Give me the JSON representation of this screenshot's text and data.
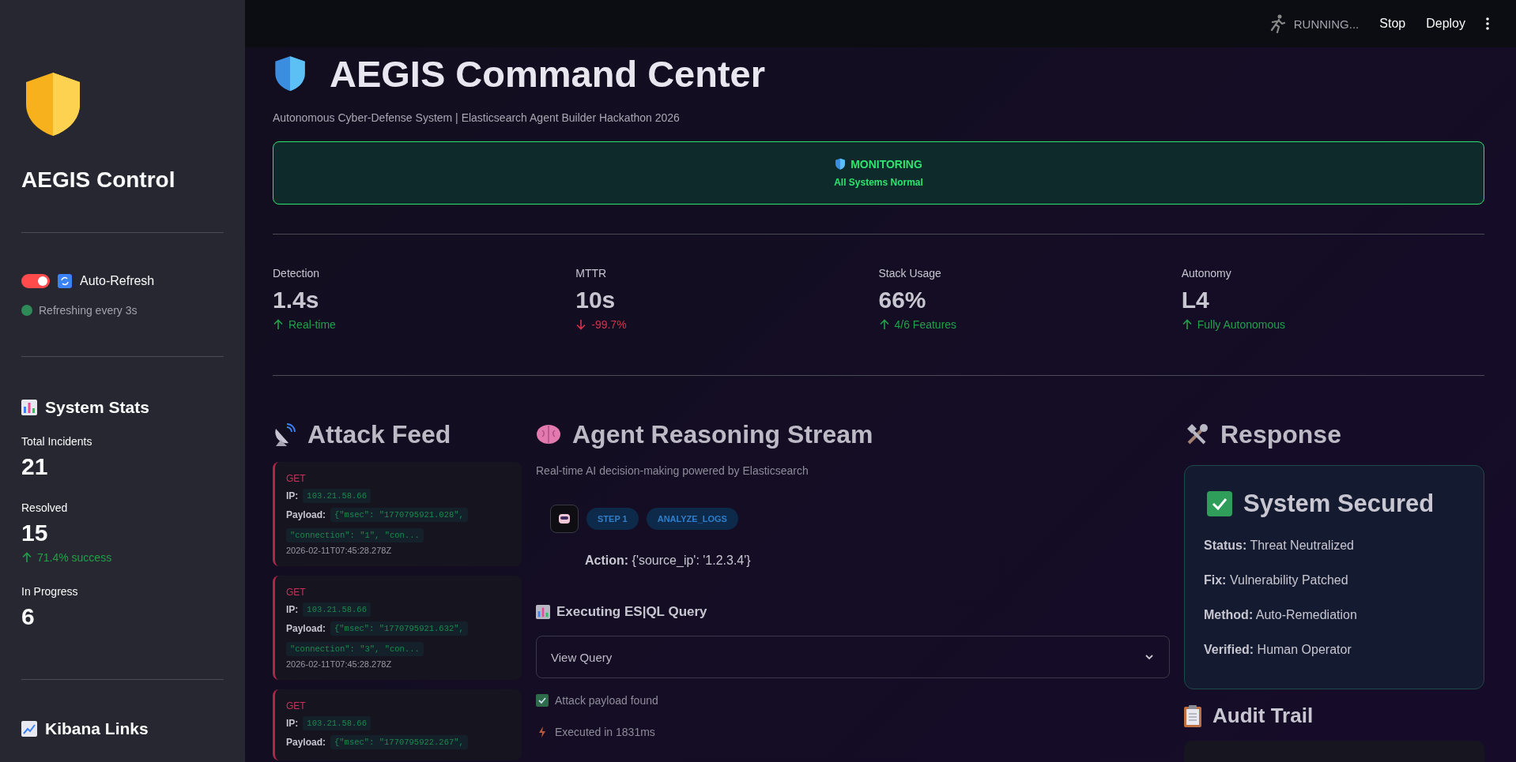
{
  "sidebar": {
    "title": "AEGIS Control",
    "auto_refresh": {
      "label": "Auto-Refresh",
      "on": true
    },
    "refresh_status": {
      "text": "Refreshing every 3s",
      "color": "#2e8b57"
    },
    "stats_heading": "System Stats",
    "stats": [
      {
        "label": "Total Incidents",
        "value": "21"
      },
      {
        "label": "Resolved",
        "value": "15",
        "delta": "71.4% success",
        "kind": "up"
      },
      {
        "label": "In Progress",
        "value": "6"
      }
    ],
    "links_heading": "Kibana Links"
  },
  "toolbar": {
    "status": "RUNNING...",
    "buttons": [
      "Stop",
      "Deploy"
    ]
  },
  "header": {
    "title": "AEGIS Command Center",
    "subtitle": "Autonomous Cyber-Defense System | Elasticsearch Agent Builder Hackathon 2026"
  },
  "banner": {
    "status": "MONITORING",
    "detail": "All Systems Normal"
  },
  "metrics": [
    {
      "label": "Detection",
      "value": "1.4s",
      "delta": "Real-time",
      "kind": "up"
    },
    {
      "label": "MTTR",
      "value": "10s",
      "delta": "-99.7%",
      "kind": "down"
    },
    {
      "label": "Stack Usage",
      "value": "66%",
      "delta": "4/6 Features",
      "kind": "up"
    },
    {
      "label": "Autonomy",
      "value": "L4",
      "delta": "Fully Autonomous",
      "kind": "up"
    }
  ],
  "attack_feed": {
    "heading": "Attack Feed",
    "events": [
      {
        "method": "GET",
        "ip_label": "IP:",
        "ip": "103.21.58.66",
        "payload_label": "Payload:",
        "payload": [
          "{\"msec\": \"1770795921.028\",",
          "\"connection\": \"1\", \"con..."
        ],
        "timestamp": "2026-02-11T07:45:28.278Z"
      },
      {
        "method": "GET",
        "ip_label": "IP:",
        "ip": "103.21.58.66",
        "payload_label": "Payload:",
        "payload": [
          "{\"msec\": \"1770795921.632\",",
          "\"connection\": \"3\", \"con..."
        ],
        "timestamp": "2026-02-11T07:45:28.278Z"
      },
      {
        "method": "GET",
        "ip_label": "IP:",
        "ip": "103.21.58.66",
        "payload_label": "Payload:",
        "payload": [
          "{\"msec\": \"1770795922.267\","
        ]
      }
    ]
  },
  "reasoning": {
    "heading": "Agent Reasoning Stream",
    "caption": "Real-time AI decision-making powered by Elasticsearch",
    "step": {
      "badges": [
        "STEP 1",
        "ANALYZE_LOGS"
      ],
      "action": "**Action:** {'source_ip': '1.2.3.4'}"
    },
    "query_heading": "Executing ES|QL Query",
    "expander": {
      "label": "View Query",
      "expanded": false
    },
    "results": [
      {
        "kind": "check",
        "text": "Attack payload found"
      },
      {
        "kind": "bolt",
        "text": "Executed in 1831ms"
      }
    ]
  },
  "response": {
    "heading": "Response",
    "card": {
      "title": "System Secured",
      "lines": [
        "**Status:** Threat Neutralized",
        "**Fix:** Vulnerability Patched",
        "**Method:** Auto-Remediation",
        "**Verified:** Human Operator"
      ]
    },
    "audit_heading": "Audit Trail"
  }
}
